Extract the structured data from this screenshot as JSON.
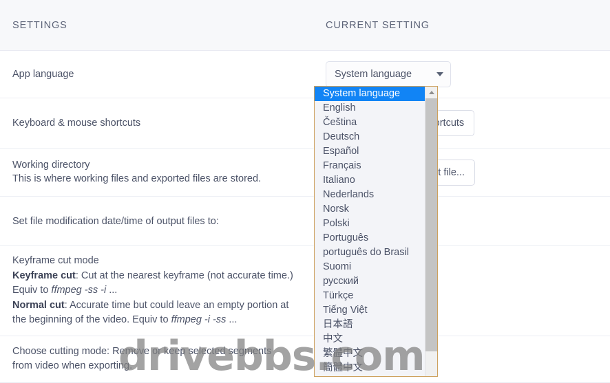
{
  "header": {
    "col_settings": "SETTINGS",
    "col_current": "CURRENT SETTING"
  },
  "rows": [
    {
      "id": "app-language",
      "label": "App language",
      "description": "",
      "control": "select",
      "control_value": "System language"
    },
    {
      "id": "keyboard-mouse-shortcuts",
      "label": "Keyboard & mouse shortcuts",
      "description": "",
      "control": "button",
      "control_value": "Keyboard & mouse shortcuts"
    },
    {
      "id": "working-directory",
      "label": "Working directory",
      "description": "This is where working files and exported files are stored.",
      "control": "button",
      "control_value": "Same directory as input file..."
    },
    {
      "id": "file-modification-date",
      "label": "Set file modification date/time of output files to:",
      "description": "",
      "control": "none",
      "control_value": ""
    },
    {
      "id": "keyframe-cut-mode",
      "label": "Keyframe cut mode",
      "description": "",
      "control": "none",
      "control_value": ""
    },
    {
      "id": "cutting-mode",
      "label": "Choose cutting mode: Remove or keep selected segments from video when exporting.",
      "description": "",
      "control": "none",
      "control_value": ""
    }
  ],
  "keyframe_desc": {
    "title": "Keyframe cut mode",
    "keyframe_cut_label": "Keyframe cut",
    "keyframe_cut_text": ": Cut at the nearest keyframe (not accurate time.) Equiv to ",
    "keyframe_cut_cmd": "ffmpeg -ss -i",
    "keyframe_cut_tail": " ...",
    "normal_cut_label": "Normal cut",
    "normal_cut_text": ": Accurate time but could leave an empty portion at the beginning of the video. Equiv to ",
    "normal_cut_cmd": "ffmpeg -i -ss",
    "normal_cut_tail": " ..."
  },
  "cutting_mode_row": {
    "line1": "Choose cutting mode: Remove or keep selected segments",
    "line2": "from video when exporting."
  },
  "language_dropdown": {
    "open": true,
    "selected": "System language",
    "options": [
      "System language",
      "English",
      "Čeština",
      "Deutsch",
      "Español",
      "Français",
      "Italiano",
      "Nederlands",
      "Norsk",
      "Polski",
      "Português",
      "português do Brasil",
      "Suomi",
      "русский",
      "Türkçe",
      "Tiếng Việt",
      "日本語",
      "中文",
      "繁體中文",
      "簡體中文"
    ],
    "scroll_up_icon": "arrow-up-icon"
  },
  "watermark": {
    "text": "drivebbs.com"
  },
  "colors": {
    "header_bg": "#f7f8fa",
    "text": "#4b5267",
    "row_divider": "#eceef4",
    "dropdown_border": "#cda15e",
    "dropdown_bg": "#f3f4f8",
    "selected_bg": "#1184f5",
    "selected_text": "#ffffff",
    "scrollbar_thumb": "#c4c4c4",
    "button_border": "#d9dce6"
  }
}
